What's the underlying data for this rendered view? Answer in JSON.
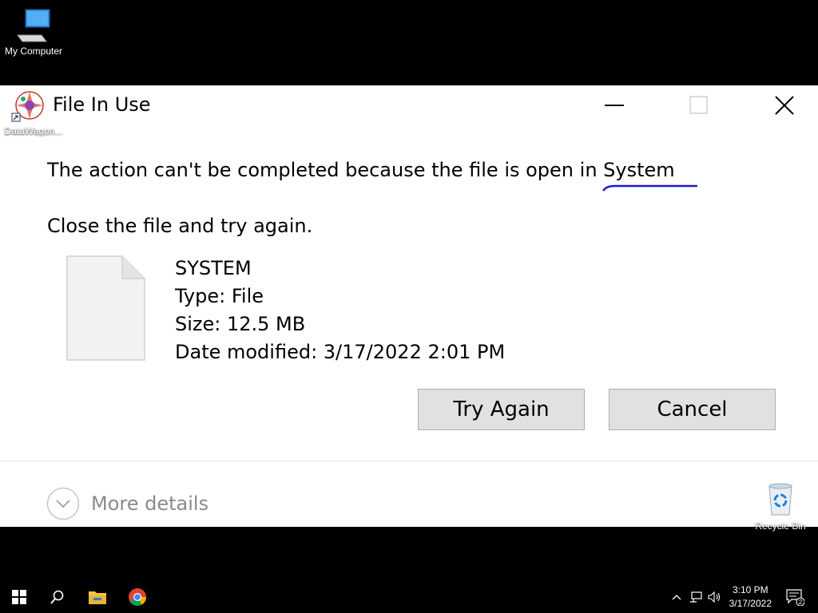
{
  "desktop": {
    "my_computer_label": "My Computer",
    "datawagon_label": "DataWagon...",
    "recycle_bin_label": "Recycle Bin"
  },
  "dialog": {
    "title": "File In Use",
    "message_prefix": "The action can't be completed because the file is open in ",
    "message_app": "System",
    "instruction": "Close the file and try again.",
    "file": {
      "name": "SYSTEM",
      "type": "Type: File",
      "size": "Size: 12.5 MB",
      "date_modified": "Date modified: 3/17/2022 2:01 PM"
    },
    "try_again_label": "Try Again",
    "cancel_label": "Cancel",
    "more_details_label": "More details"
  },
  "taskbar": {
    "time": "3:10 PM",
    "date": "3/17/2022",
    "notification_count": "2",
    "icons": [
      "start-icon",
      "search-icon",
      "file-explorer-icon",
      "chrome-icon"
    ]
  },
  "colors": {
    "squiggle": "#1a1ad6",
    "button_bg": "#e1e1e1",
    "button_border": "#adadad"
  }
}
